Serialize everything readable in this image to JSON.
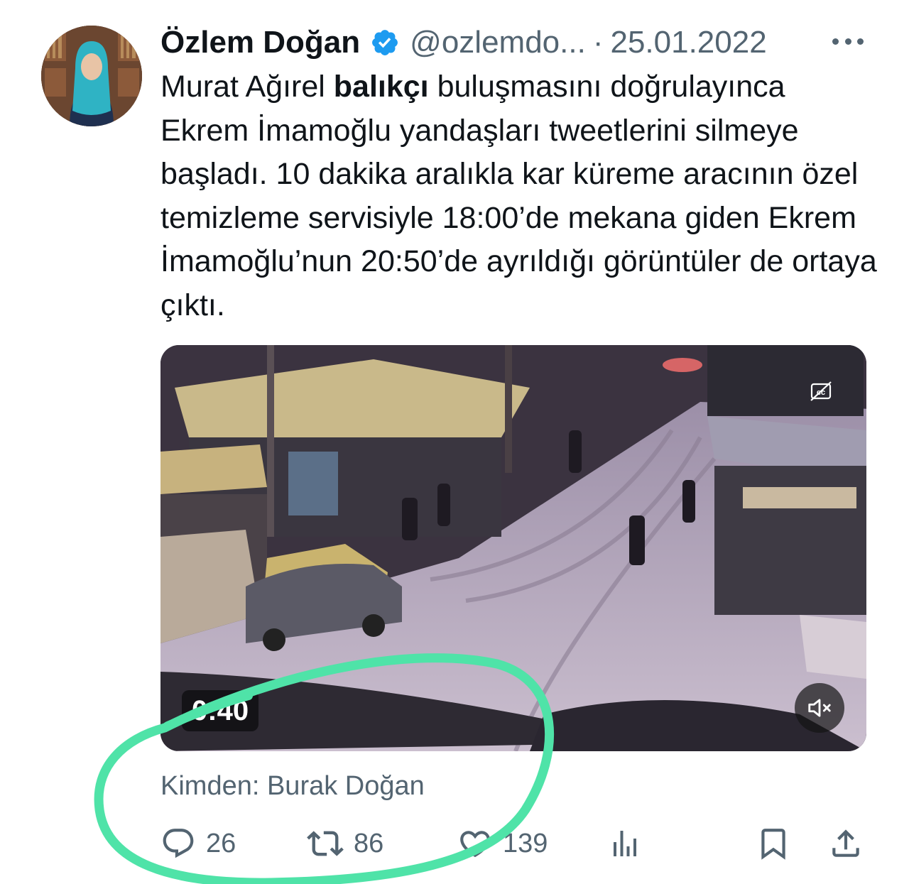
{
  "author": {
    "name": "Özlem Doğan",
    "handle": "@ozlemdo...",
    "separator": "·",
    "date": "25.01.2022",
    "verified_icon": "verified-badge-icon"
  },
  "tweet": {
    "text_before_bold": "Murat Ağırel ",
    "text_bold": "balıkçı",
    "text_after_bold": " buluşmasını doğrulayınca Ekrem İmamoğlu yandaşları tweetlerini silmeye başladı. 10 dakika aralıkla kar küreme aracının özel temizleme servisiyle 18:00’de mekana giden Ekrem İmamoğlu’nun 20:50’de ayrıldığı görüntüler de ortaya çıktı."
  },
  "media": {
    "type": "video",
    "timestamp": "0:40",
    "mute_icon": "speaker-muted-icon",
    "cc_icon": "closed-captions-icon"
  },
  "source_label": "Kimden: Burak Doğan",
  "actions": {
    "replies": "26",
    "retweets": "86",
    "likes": "139",
    "colors": {
      "icon": "#536471"
    }
  },
  "annotation": {
    "color": "#4fe3a8",
    "shape": "hand-drawn circle"
  }
}
